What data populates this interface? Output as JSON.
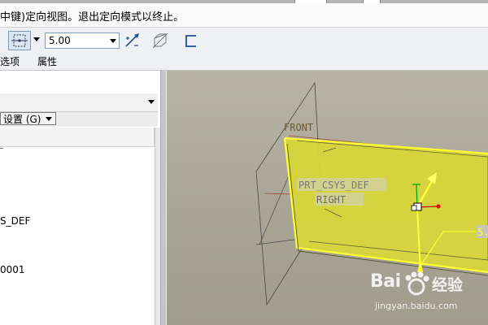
{
  "message_bar": {
    "text": "中键)定向视图。退出定向模式以终止。"
  },
  "dashboard": {
    "offset_value": "5.00",
    "icons": [
      "plane-reference-icon",
      "flip-direction-icon",
      "thicken-icon",
      "sketch-feature-icon"
    ],
    "tabs": [
      "选项",
      "属性"
    ]
  },
  "left_panel": {
    "settings_label": "设置 (G)",
    "tree_items": [
      "S_DEF",
      "0001"
    ]
  },
  "viewport": {
    "labels": {
      "front": "FRONT",
      "csys": "PRT_CSYS_DEF",
      "right": "RIGHT",
      "dim": "5."
    },
    "colors": {
      "background": "#a8a596",
      "surface_fill": "#d7d63a",
      "surface_edge": "#ffff33",
      "label_text": "#6b5a2e",
      "handle_dot": "#ff0000",
      "axis_green": "#00a000"
    }
  },
  "watermark": {
    "logo": "Bai",
    "cn": "经验",
    "url": "jingyan.baidu.com"
  }
}
